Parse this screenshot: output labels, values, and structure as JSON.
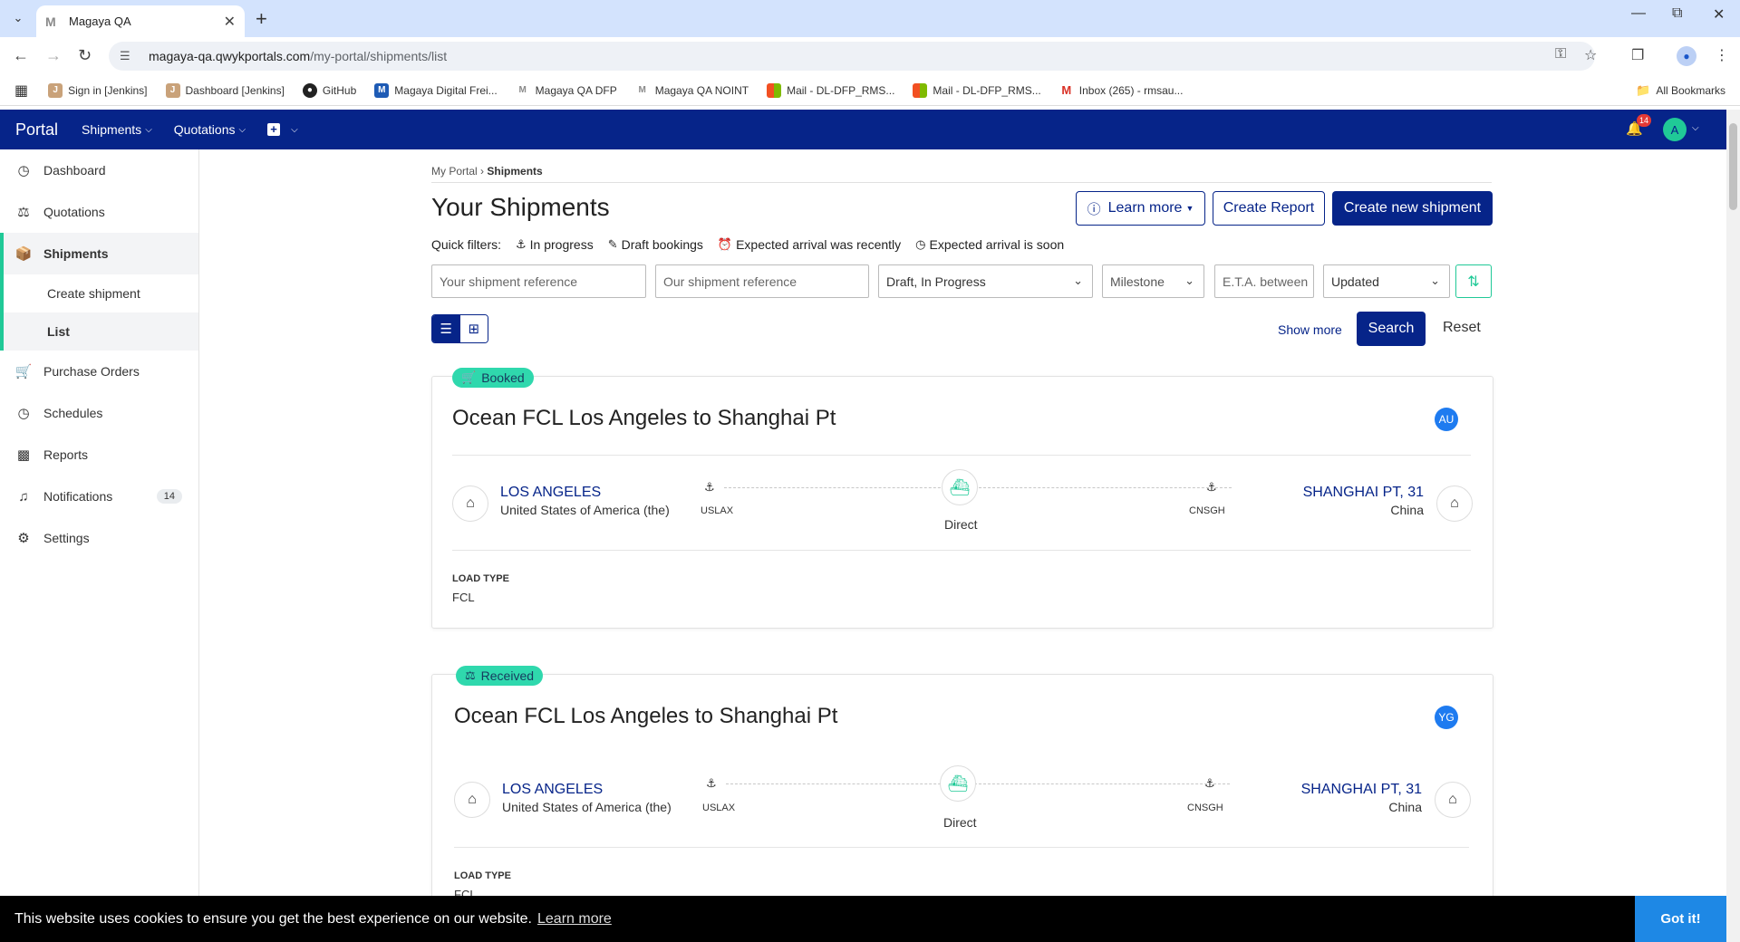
{
  "browser": {
    "tab_title": "Magaya QA",
    "tab_icon": "M",
    "url_host": "magaya-qa.qwykportals.com",
    "url_path": "/my-portal/shipments/list",
    "bookmarks": [
      {
        "label": "Sign in [Jenkins]",
        "icon": "jenkins-icon",
        "color": "#c9a27a"
      },
      {
        "label": "Dashboard [Jenkins]",
        "icon": "jenkins-icon",
        "color": "#c9a27a"
      },
      {
        "label": "GitHub",
        "icon": "github-icon",
        "color": "#222222"
      },
      {
        "label": "Magaya Digital Frei...",
        "icon": "magaya-icon",
        "color": "#1e5bb5"
      },
      {
        "label": "Magaya QA DFP",
        "icon": "magaya-icon",
        "color": "#8a8a8a"
      },
      {
        "label": "Magaya QA NOINT",
        "icon": "magaya-icon",
        "color": "#8a8a8a"
      },
      {
        "label": "Mail - DL-DFP_RMS...",
        "icon": "microsoft-icon",
        "color": "#f25022"
      },
      {
        "label": "Mail - DL-DFP_RMS...",
        "icon": "microsoft-icon",
        "color": "#f25022"
      },
      {
        "label": "Inbox (265) - rmsau...",
        "icon": "gmail-icon",
        "color": "#d93025"
      }
    ],
    "all_bookmarks": "All Bookmarks"
  },
  "header": {
    "brand": "Portal",
    "nav": [
      {
        "label": "Shipments"
      },
      {
        "label": "Quotations"
      }
    ],
    "notification_count": "14",
    "user_initial": "A"
  },
  "sidebar": {
    "items": [
      {
        "label": "Dashboard",
        "icon": "dashboard-icon"
      },
      {
        "label": "Quotations",
        "icon": "quotations-icon"
      },
      {
        "label": "Shipments",
        "icon": "shipments-icon"
      },
      {
        "label": "Purchase Orders",
        "icon": "cart-icon"
      },
      {
        "label": "Schedules",
        "icon": "clock-icon"
      },
      {
        "label": "Reports",
        "icon": "chart-icon"
      },
      {
        "label": "Notifications",
        "icon": "bell-icon",
        "badge": "14"
      },
      {
        "label": "Settings",
        "icon": "gear-icon"
      }
    ],
    "sub": [
      {
        "label": "Create shipment"
      },
      {
        "label": "List"
      }
    ]
  },
  "page": {
    "breadcrumb_root": "My Portal",
    "breadcrumb_current": "Shipments",
    "title": "Your Shipments",
    "learn_more": "Learn more",
    "create_report": "Create Report",
    "create_shipment": "Create new shipment",
    "quick_filters_label": "Quick filters:",
    "quick_filters": [
      {
        "label": "In progress",
        "icon": "ship-icon"
      },
      {
        "label": "Draft bookings",
        "icon": "pencil-icon"
      },
      {
        "label": "Expected arrival was recently",
        "icon": "alarm-icon"
      },
      {
        "label": "Expected arrival is soon",
        "icon": "clock-icon"
      }
    ],
    "filters": {
      "your_ref_placeholder": "Your shipment reference",
      "our_ref_placeholder": "Our shipment reference",
      "status_value": "Draft, In Progress",
      "milestone_value": "Milestone",
      "eta_placeholder": "E.T.A. between",
      "sort_value": "Updated"
    },
    "show_more": "Show more",
    "search": "Search",
    "reset": "Reset"
  },
  "shipments": [
    {
      "status": "Booked",
      "title": "Ocean FCL Los Angeles to Shanghai Pt",
      "assignee_initials": "AU",
      "origin_name": "LOS ANGELES",
      "origin_country": "United States of America (the)",
      "origin_code": "USLAX",
      "route": "Direct",
      "dest_code": "CNSGH",
      "dest_name": "SHANGHAI PT, 31",
      "dest_country": "China",
      "load_type_label": "LOAD TYPE",
      "load_type": "FCL"
    },
    {
      "status": "Received",
      "title": "Ocean FCL Los Angeles to Shanghai Pt",
      "assignee_initials": "YG",
      "origin_name": "LOS ANGELES",
      "origin_country": "United States of America (the)",
      "origin_code": "USLAX",
      "route": "Direct",
      "dest_code": "CNSGH",
      "dest_name": "SHANGHAI PT, 31",
      "dest_country": "China",
      "load_type_label": "LOAD TYPE",
      "load_type": "FCL"
    }
  ],
  "cookie": {
    "message": "This website uses cookies to ensure you get the best experience on our website.",
    "learn_more": "Learn more",
    "accept": "Got it!"
  },
  "colors": {
    "primary": "#062489",
    "accent": "#20c997",
    "status_pill": "#2fd8ad",
    "avatar_blue": "#1e7bf0"
  }
}
